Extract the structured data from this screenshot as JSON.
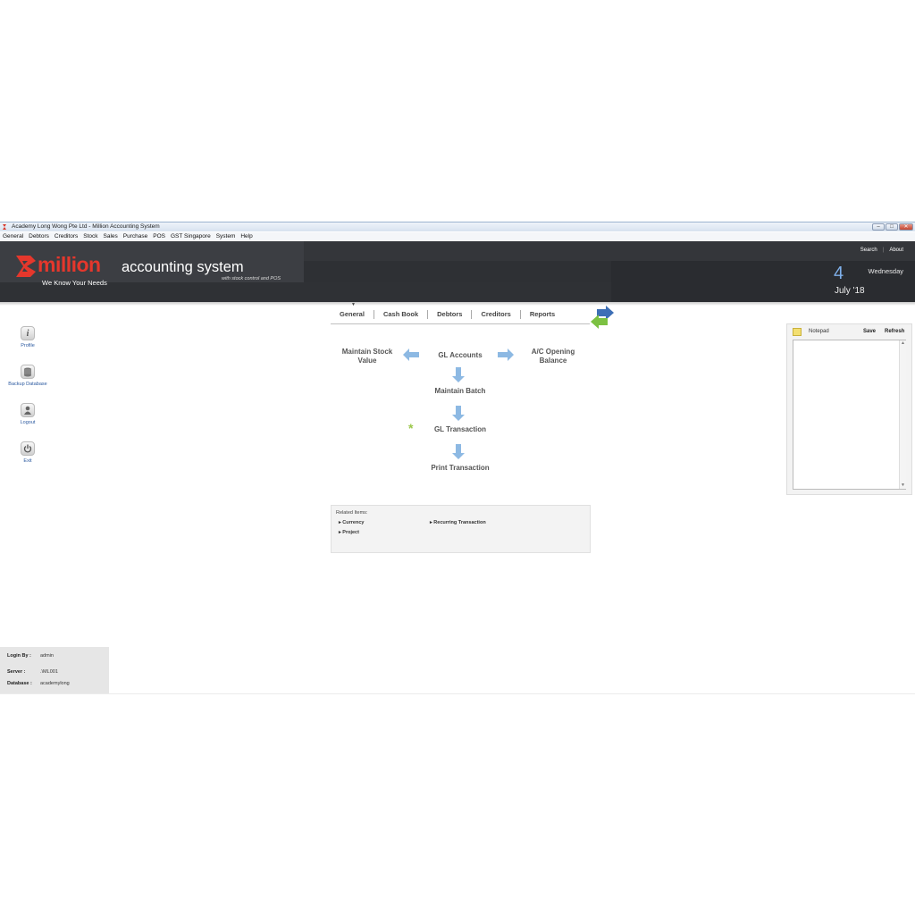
{
  "window": {
    "title": "Academy Long Wong Pte Ltd - Million Accounting System",
    "buttons": [
      "–",
      "□",
      "✕"
    ]
  },
  "menu": [
    "General",
    "Debtors",
    "Creditors",
    "Stock",
    "Sales",
    "Purchase",
    "POS",
    "GST Singapore",
    "System",
    "Help"
  ],
  "header": {
    "brand": "million",
    "tagline": "We Know Your Needs",
    "product": "accounting system",
    "subtitle": "with stock control and POS",
    "links": {
      "search": "Search",
      "about": "About"
    },
    "date": {
      "day_number": "4",
      "weekday": "Wednesday",
      "month_year": "July '18"
    },
    "colors": {
      "brand_red": "#e5372c",
      "header_bg": "#3c3e43",
      "date_blue": "#7fb0ea"
    }
  },
  "tabs": [
    "General",
    "Cash Book",
    "Debtors",
    "Creditors",
    "Reports"
  ],
  "sidebar": [
    {
      "label": "Profile",
      "icon": "info-icon"
    },
    {
      "label": "Backup Database",
      "icon": "database-icon"
    },
    {
      "label": "Logout",
      "icon": "user-icon"
    },
    {
      "label": "Exit",
      "icon": "power-icon"
    }
  ],
  "flow": {
    "maintain_stock_value": "Maintain Stock Value",
    "gl_accounts": "GL Accounts",
    "ac_opening_balance": "A/C Opening Balance",
    "maintain_batch": "Maintain Batch",
    "gl_transaction": "GL Transaction",
    "print_transaction": "Print Transaction"
  },
  "related": {
    "heading": "Related Items:",
    "items": [
      "Currency",
      "Recurring Transaction",
      "Project"
    ]
  },
  "notepad": {
    "title": "Notepad",
    "save": "Save",
    "refresh": "Refresh",
    "content": ""
  },
  "status": {
    "login_label": "Login By :",
    "login_value": "admin",
    "server_label": "Server :",
    "server_value": ".\\ML001",
    "database_label": "Database :",
    "database_value": "academylong"
  }
}
